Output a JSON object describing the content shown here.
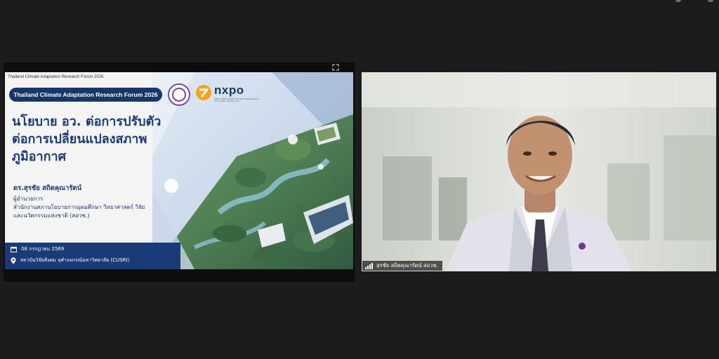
{
  "share": {
    "header": "Thailand Climate Adaptation Research Forum 2026",
    "pill": "Thailand Climate Adaptation Research Forum 2026",
    "nxpo_text": "nxpo",
    "nxpo_subtitle": "Office of National Higher Education Science Research and Innovation Policy Council",
    "title_line1": "นโยบาย อว. ต่อการปรับตัว",
    "title_line2": "ต่อการเปลี่ยนแปลงสภาพ",
    "title_line3": "ภูมิอากาศ",
    "speaker": "ดร.สุรชัย สถิตคุณารัตน์",
    "role_line1": "ผู้อำนวยการ",
    "role_line2": "สำนักงานสภานโยบายการอุดมศึกษา วิทยาศาสตร์ วิจัย",
    "role_line3": "และนวัตกรรมแห่งชาติ (สอวช.)",
    "date": "08 กรกฎาคม 2569",
    "venue": "สถาบันวิจัยสังคม จุฬาลงกรณ์มหาวิทยาลัย (CUSRI)"
  },
  "camera": {
    "participant_name": "สุรชัย สถิตคุณารัตน์ สอวช.",
    "icon": "signal-bars-icon"
  },
  "colors": {
    "background": "#1c1c1c",
    "slide_navy": "#1b3a78",
    "nxpo_orange": "#f7a21b"
  }
}
